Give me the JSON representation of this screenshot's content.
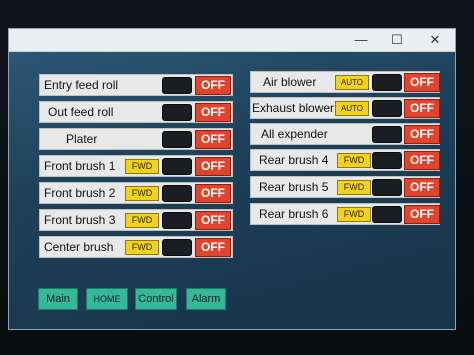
{
  "window": {
    "min_icon": "minimize-icon",
    "max_icon": "maximize-icon",
    "close_icon": "close-icon"
  },
  "left_rows": [
    {
      "label": "Entry feed roll",
      "off": "OFF"
    },
    {
      "label": "Out feed roll",
      "off": "OFF"
    },
    {
      "label": "Plater",
      "off": "OFF"
    },
    {
      "label": "Front brush 1",
      "fwd": "FWD",
      "off": "OFF"
    },
    {
      "label": "Front brush 2",
      "fwd": "FWD",
      "off": "OFF"
    },
    {
      "label": "Front brush 3",
      "fwd": "FWD",
      "off": "OFF"
    },
    {
      "label": "Center brush",
      "fwd": "FWD",
      "off": "OFF"
    }
  ],
  "right_rows": [
    {
      "label": "Air blower",
      "auto": "AUTO",
      "off": "OFF"
    },
    {
      "label": "Exhaust blower",
      "auto": "AUTO",
      "off": "OFF"
    },
    {
      "label": "All expender",
      "off": "OFF"
    },
    {
      "label": "Rear brush 4",
      "fwd": "FWD",
      "off": "OFF"
    },
    {
      "label": "Rear brush 5",
      "fwd": "FWD",
      "off": "OFF"
    },
    {
      "label": "Rear brush 6",
      "fwd": "FWD",
      "off": "OFF"
    }
  ],
  "nav": {
    "main": "Main",
    "home": "HOME",
    "control": "Control",
    "alarm": "Alarm"
  },
  "colors": {
    "off": "#e2432c",
    "fwd": "#f2d21a",
    "nav": "#35b79a"
  }
}
